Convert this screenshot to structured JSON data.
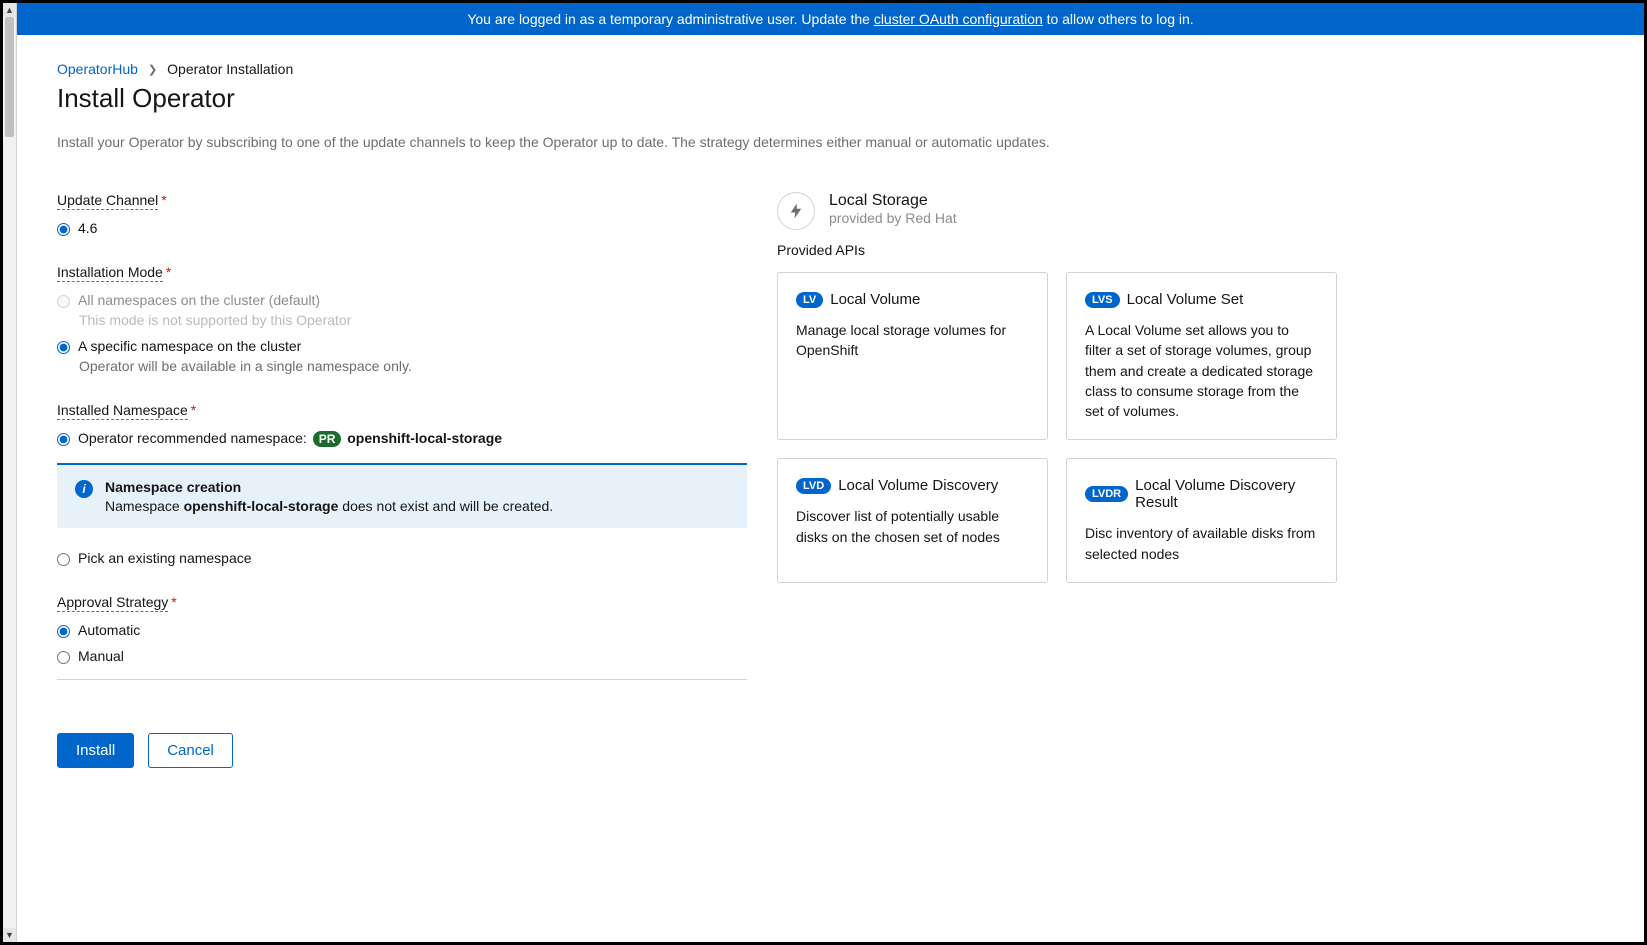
{
  "banner": {
    "prefix": "You are logged in as a temporary administrative user. Update the ",
    "link": "cluster OAuth configuration",
    "suffix": " to allow others to log in."
  },
  "breadcrumb": {
    "root": "OperatorHub",
    "current": "Operator Installation"
  },
  "page": {
    "title": "Install Operator",
    "description": "Install your Operator by subscribing to one of the update channels to keep the Operator up to date. The strategy determines either manual or automatic updates."
  },
  "updateChannel": {
    "label": "Update Channel",
    "option": "4.6"
  },
  "installMode": {
    "label": "Installation Mode",
    "allNs": "All namespaces on the cluster (default)",
    "allNsHelper": "This mode is not supported by this Operator",
    "specificNs": "A specific namespace on the cluster",
    "specificNsHelper": "Operator will be available in a single namespace only."
  },
  "installedNs": {
    "label": "Installed Namespace",
    "recommendedPrefix": "Operator recommended namespace: ",
    "badge": "PR",
    "nsName": "openshift-local-storage",
    "pickExisting": "Pick an existing namespace",
    "alertTitle": "Namespace creation",
    "alertPrefix": "Namespace ",
    "alertNs": "openshift-local-storage",
    "alertSuffix": " does not exist and will be created."
  },
  "approval": {
    "label": "Approval Strategy",
    "automatic": "Automatic",
    "manual": "Manual"
  },
  "actions": {
    "install": "Install",
    "cancel": "Cancel"
  },
  "operator": {
    "name": "Local Storage",
    "provider": "provided by Red Hat",
    "apisLabel": "Provided APIs",
    "apis": [
      {
        "badge": "LV",
        "title": "Local Volume",
        "desc": "Manage local storage volumes for OpenShift"
      },
      {
        "badge": "LVS",
        "title": "Local Volume Set",
        "desc": "A Local Volume set allows you to filter a set of storage volumes, group them and create a dedicated storage class to consume storage from the set of volumes."
      },
      {
        "badge": "LVD",
        "title": "Local Volume Discovery",
        "desc": "Discover list of potentially usable disks on the chosen set of nodes"
      },
      {
        "badge": "LVDR",
        "title": "Local Volume Discovery Result",
        "desc": "Disc inventory of available disks from selected nodes"
      }
    ]
  }
}
